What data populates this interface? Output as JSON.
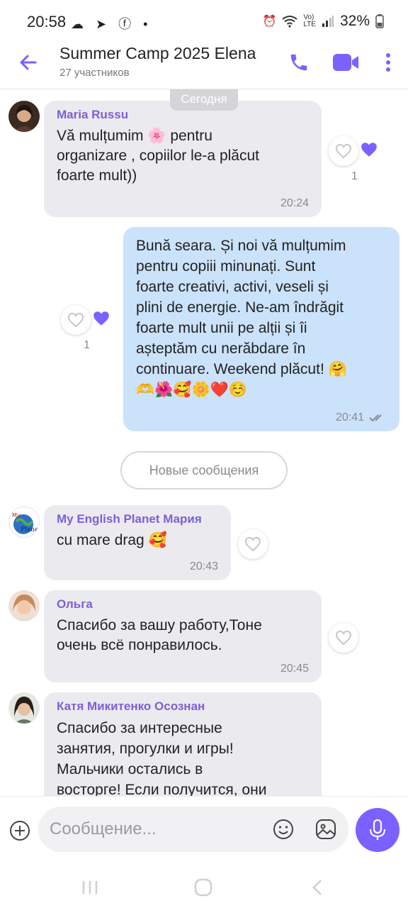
{
  "status_bar": {
    "time": "20:58",
    "left_icons": "☁ ➤ ⓕ •",
    "battery": "32%"
  },
  "header": {
    "title": "Summer Camp 2025 Elena",
    "subtitle": "27 участников"
  },
  "chat": {
    "date_label": "Сегодня",
    "new_messages_label": "Новые сообщения",
    "messages": [
      {
        "sender": "Maria Russu",
        "text": "Vă mulțumim 🌸 pentru\norganizare , copiilor le-a plăcut\nfoarte mult))",
        "time": "20:24",
        "reaction_count": "1"
      },
      {
        "text": "Bună seara. Și  noi vă  mulțumim\npentru copiii minunați. Sunt\nfoarte creativi, activi, veseli și\nplini de energie. Ne-am îndrăgit\nfoarte mult unii pe alții și îi\nașteptăm cu nerăbdare în\ncontinuare. Weekend plăcut! 🤗\n🫶🌺🥰🌼❤️☺️",
        "time": "20:41",
        "reaction_count": "1"
      },
      {
        "sender": "My English Planet Мария",
        "text": "cu mare drag 🥰",
        "time": "20:43"
      },
      {
        "sender": "Ольга",
        "text": "Спасибо за вашу работу,Тоне\nочень всё понравилось.",
        "time": "20:45"
      },
      {
        "sender": "Катя Микитенко Осознан",
        "text": "Спасибо за интересные\nзанятия, прогулки и игры!\nМальчики остались в\nвосторге! Если получится, они"
      }
    ]
  },
  "composer": {
    "placeholder": "Сообщение..."
  },
  "colors": {
    "accent": "#7b61ff",
    "sender_name": "#7d5fd6",
    "incoming_bubble": "#ebebef",
    "outgoing_bubble": "#cbe2fb"
  },
  "icons": {
    "header": [
      "back-arrow-icon",
      "phone-icon",
      "video-icon",
      "more-vert-icon"
    ],
    "composer": [
      "plus-icon",
      "emoji-icon",
      "sticker-icon",
      "mic-icon"
    ],
    "reactions": [
      "heart-outline-icon",
      "heart-filled-icon"
    ]
  }
}
